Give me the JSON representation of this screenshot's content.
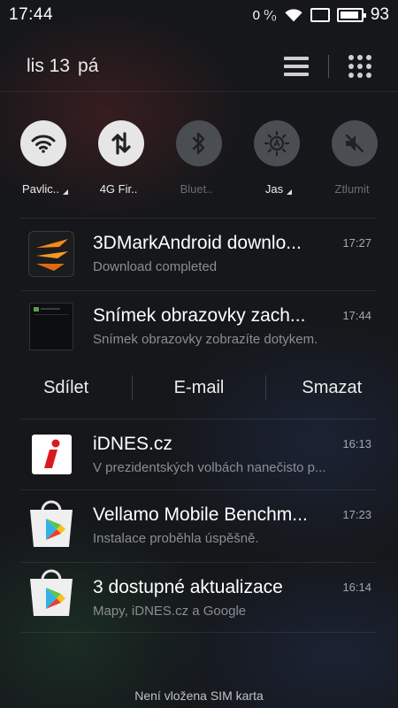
{
  "status_bar": {
    "time": "17:44",
    "data_rate": "0 ⁰⁄₀",
    "battery_level": 0.93,
    "battery_percent": "93"
  },
  "header": {
    "date_day": "lis 13",
    "date_weekday": "pá"
  },
  "toggles": [
    {
      "label": "Pavlic..",
      "icon": "wifi-icon",
      "state": "on"
    },
    {
      "label": "4G Fir..",
      "icon": "mobile-data-icon",
      "state": "on"
    },
    {
      "label": "Bluet..",
      "icon": "bluetooth-icon",
      "state": "off"
    },
    {
      "label": "Jas",
      "icon": "brightness-icon",
      "state": "off"
    },
    {
      "label": "Ztlumit",
      "icon": "mute-icon",
      "state": "off"
    }
  ],
  "notifications": [
    {
      "icon": "3dmark-icon",
      "title": "3DMarkAndroid downlo...",
      "text": "Download completed",
      "time": "17:27"
    },
    {
      "icon": "screenshot-thumbnail-icon",
      "title": "Snímek obrazovky zach...",
      "text": "Snímek obrazovky zobrazíte dotykem.",
      "time": "17:44"
    },
    {
      "icon": "idnes-icon",
      "title": "iDNES.cz",
      "text": "V prezidentských volbách nanečisto p...",
      "time": "16:13"
    },
    {
      "icon": "play-store-icon",
      "title": "Vellamo Mobile Benchm...",
      "text": "Instalace proběhla úspěšně.",
      "time": "17:23"
    },
    {
      "icon": "play-store-icon",
      "title": "3 dostupné aktualizace",
      "text": "Mapy, iDNES.cz a Google",
      "time": "16:14"
    }
  ],
  "screenshot_actions": {
    "share": "Sdílet",
    "email": "E-mail",
    "delete": "Smazat"
  },
  "footer": {
    "sim_status": "Není vložena SIM karta"
  }
}
